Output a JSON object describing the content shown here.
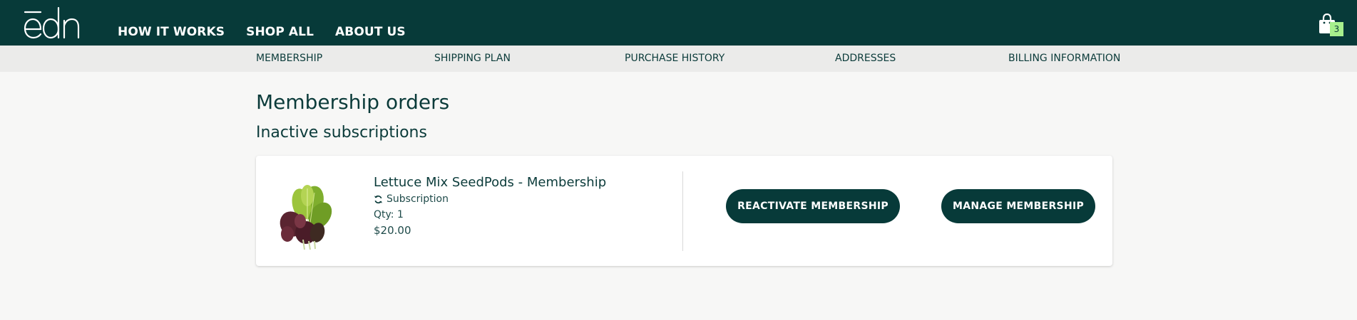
{
  "brand": {
    "logo_text": "ēdn",
    "primary_color": "#073a39",
    "accent_color": "#a7f08d"
  },
  "header": {
    "nav": [
      {
        "label": "HOW IT WORKS"
      },
      {
        "label": "SHOP ALL"
      },
      {
        "label": "ABOUT US"
      }
    ],
    "cart": {
      "icon": "shopping-bag-icon",
      "count": "3"
    }
  },
  "account_nav": {
    "items": [
      {
        "label": "MEMBERSHIP"
      },
      {
        "label": "SHIPPING PLAN"
      },
      {
        "label": "PURCHASE HISTORY"
      },
      {
        "label": "ADDRESSES"
      },
      {
        "label": "BILLING INFORMATION"
      }
    ]
  },
  "main": {
    "title": "Membership orders",
    "section_title": "Inactive subscriptions",
    "orders": [
      {
        "name": "Lettuce Mix SeedPods - Membership",
        "type_icon": "refresh-icon",
        "type_label": "Subscription",
        "qty": "Qty: 1",
        "price": "$20.00",
        "image": "lettuce-mix-image",
        "reactivate_label": "REACTIVATE MEMBERSHIP",
        "manage_label": "MANAGE MEMBERSHIP"
      }
    ]
  }
}
